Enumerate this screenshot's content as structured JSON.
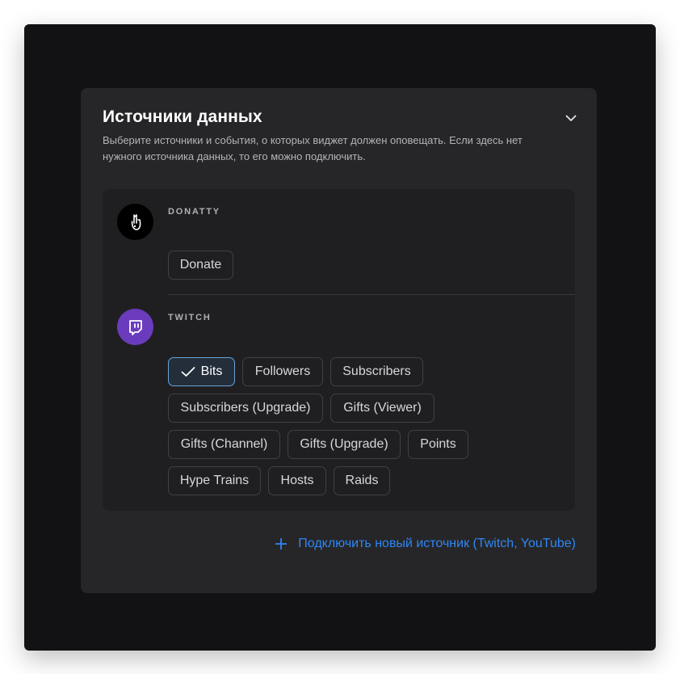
{
  "panel": {
    "title": "Источники данных",
    "description": "Выберите источники и события, о которых виджет должен оповещать. Если здесь нет нужного источника данных, то его можно подключить."
  },
  "sources": {
    "donatty": {
      "name": "DONATTY",
      "icon": "donatty-hand-icon",
      "events": [
        {
          "label": "Donate",
          "selected": false
        }
      ]
    },
    "twitch": {
      "name": "TWITCH",
      "icon": "twitch-icon",
      "events": [
        {
          "label": "Bits",
          "selected": true
        },
        {
          "label": "Followers",
          "selected": false
        },
        {
          "label": "Subscribers",
          "selected": false
        },
        {
          "label": "Subscribers (Upgrade)",
          "selected": false
        },
        {
          "label": "Gifts (Viewer)",
          "selected": false
        },
        {
          "label": "Gifts (Channel)",
          "selected": false
        },
        {
          "label": "Gifts (Upgrade)",
          "selected": false
        },
        {
          "label": "Points",
          "selected": false
        },
        {
          "label": "Hype Trains",
          "selected": false
        },
        {
          "label": "Hosts",
          "selected": false
        },
        {
          "label": "Raids",
          "selected": false
        }
      ]
    }
  },
  "connect_link": {
    "label": "Подключить новый источник (Twitch, YouTube)",
    "icon": "plus-icon"
  },
  "colors": {
    "accent": "#2e86f5",
    "twitch_brand": "#6a3cbd",
    "selected_border": "#6aa3d8"
  }
}
